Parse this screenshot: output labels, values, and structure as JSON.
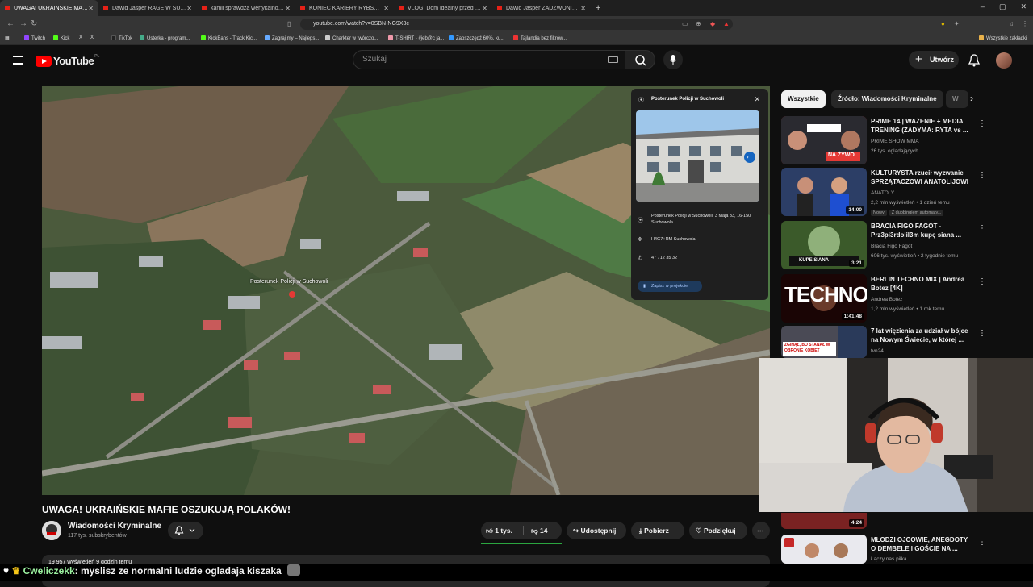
{
  "browser": {
    "tabs": [
      {
        "label": "UWAGA! UKRAIŃSKIE MAFIE",
        "active": true
      },
      {
        "label": "Dawid Jasper RAGE W SUPER MARIO"
      },
      {
        "label": "kamil sprawdza wertykalność dema"
      },
      {
        "label": "KONIEC KARIERY RYBSONA! PORÓD"
      },
      {
        "label": "VLOG: Dom idealny przed przyjazdem"
      },
      {
        "label": "Dawid Jasper ZADZWONIŁ NA POLICJĘ"
      }
    ],
    "new_tab": "+",
    "url": "youtube.com/watch?v=0SBN-NG9X3c",
    "bookmarks": [
      "Twitch",
      "Kick",
      "X",
      "X",
      "TikTok",
      "Usterka - program...",
      "KickBans - Track Kic...",
      "Zagraj.my – Najleps...",
      "Charkter w twórczo...",
      "T-SHIRT - #jeb@c ja...",
      "Zaoszczędź 60%, ku...",
      "Tajlandia bez filtrów..."
    ],
    "bookmarks_folder": "Wszystkie zakładki",
    "window_controls": [
      "–",
      "▢",
      "✕"
    ]
  },
  "youtube": {
    "logo": "YouTube",
    "country": "PL",
    "search_placeholder": "Szukaj",
    "create_label": "Utwórz"
  },
  "video": {
    "title": "UWAGA! UKRAIŃSKIE MAFIE OSZUKUJĄ POLAKÓW!",
    "channel": "Wiadomości Kryminalne",
    "subscribers": "117 tys. subskrybentów",
    "likes": "1 tys.",
    "dislikes": "14",
    "share": "Udostępnij",
    "download": "Pobierz",
    "thanks": "Podziękuj",
    "views_partial": "19 957 wyświetleń  9 godzin temu",
    "map_pin_label": "Posterunek Policji w Suchowoli"
  },
  "map_card": {
    "title": "Posterunek Policji w Suchowoli",
    "address": "Posterunek Policji w Suchowoli, 3 Maja 33, 16-150 Suchowola",
    "plus_code": "H4G7+RM Suchowola",
    "phone": "47 712 35 32",
    "save": "Zapisz w projekcie"
  },
  "sidebar": {
    "chips": [
      "Wszystkie",
      "Źródło: Wiadomości Kryminalne",
      "W"
    ],
    "recommendations": [
      {
        "title": "PRIME 14 | WAŻENIE + MEDIA TRENING (ZADYMA: RYTA vs ...",
        "channel": "PRIME SHOW MMA",
        "meta": "26 tys. oglądających",
        "duration": "",
        "thumb_text": "NA ŻYWO",
        "thumb_color": "#8a1b1b"
      },
      {
        "title": "KULTURYSTA rzucił wyzwanie SPRZĄTACZOWI ANATOLIJOWI",
        "channel": "ANATOLY",
        "meta": "2,2 mln wyświetleń • 1 dzień temu",
        "duration": "14:00",
        "badges": [
          "Nowy",
          "Z dubbingiem automaty..."
        ],
        "thumb_color": "#2c3e66"
      },
      {
        "title": "BRACIA FIGO FAGOT - Prz3pi3rdolil3m kupę siana ...",
        "channel": "Bracia Figo Fagot",
        "meta": "606 tys. wyświetleń • 2 tygodnie temu",
        "duration": "3:21",
        "thumb_text": "KUPE SIANA",
        "thumb_color": "#3b5a2a"
      },
      {
        "title": "BERLIN TECHNO MIX | Andrea Botez [4K]",
        "channel": "Andrea Botez",
        "meta": "1,2 mln wyświetleń • 1 rok temu",
        "duration": "1:41:48",
        "thumb_text": "TECHNO",
        "thumb_color": "#5c0b0b"
      },
      {
        "title": "7 lat więzienia za udział w bójce na Nowym Świecie, w której ...",
        "channel": "tvn24",
        "meta": "",
        "duration": "",
        "thumb_text": "ZGINĄŁ, BO STANĄŁ W OBRONIE KOBIET",
        "thumb_color": "#4a4a55"
      },
      {
        "title": "MŁODZI OJCOWIE, ANEGDOTY O DEMBELE I GOŚCIE NA ...",
        "channel": "Łączy nas piłka",
        "meta": "",
        "duration": "4:24",
        "thumb_color": "#7a2222"
      }
    ]
  },
  "chat": {
    "user": "Cweliczekk",
    "message": ": myslisz ze normalni ludzie ogladaja kiszaka"
  },
  "colors": {
    "accent": "#ff0000",
    "like_bar": "#2ba640",
    "chat_user": "#9bf09f"
  }
}
